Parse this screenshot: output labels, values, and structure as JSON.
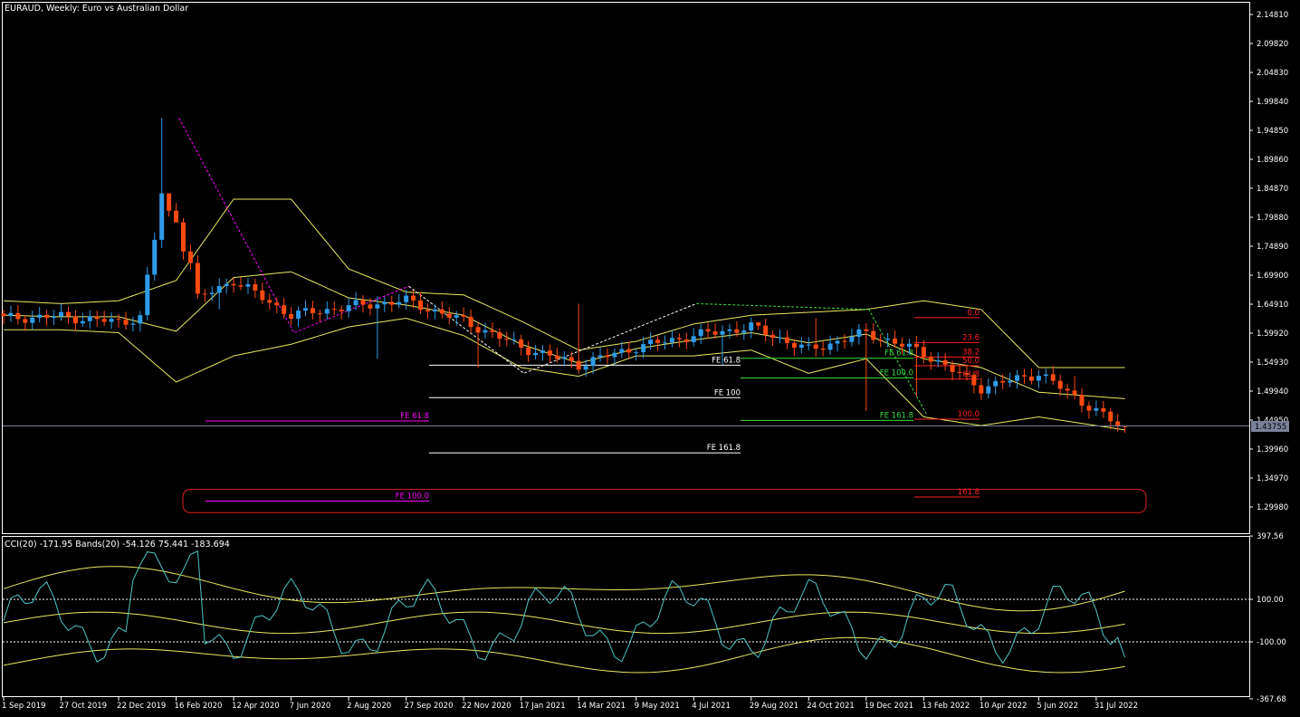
{
  "header": {
    "main_title": "EURAUD, Weekly:  Euro vs Australian Dollar",
    "indicator_title": "CCI(20) -171.95 Bands(20) -54.126 75.441 -183.694"
  },
  "colors": {
    "background": "#000000",
    "bull": "#2E9BE8",
    "bear": "#FF4A10",
    "bands": "#E8E860",
    "cci": "#4FC4C4",
    "fib_white": "#FFFFFF",
    "fib_magenta": "#FF00FF",
    "fib_green": "#3CDC3C",
    "fib_red": "#FF2020",
    "price_line": "#7A8299"
  },
  "price_axis": {
    "ticks": [
      "2.14810",
      "2.09820",
      "2.04830",
      "1.99840",
      "1.94850",
      "1.89860",
      "1.84870",
      "1.79880",
      "1.74890",
      "1.69900",
      "1.64910",
      "1.59920",
      "1.54930",
      "1.49940",
      "1.44950",
      "1.39960",
      "1.34970",
      "1.29980"
    ],
    "current_price": "1.43755"
  },
  "cci_axis": {
    "ticks": [
      "397.56",
      "100.00",
      "-100.00",
      "-367.68"
    ]
  },
  "time_axis": {
    "labels": [
      "1 Sep 2019",
      "27 Oct 2019",
      "22 Dec 2019",
      "16 Feb 2020",
      "12 Apr 2020",
      "7 Jun 2020",
      "2 Aug 2020",
      "27 Sep 2020",
      "22 Nov 2020",
      "17 Jan 2021",
      "14 Mar 2021",
      "9 May 2021",
      "4 Jul 2021",
      "29 Aug 2021",
      "24 Oct 2021",
      "19 Dec 2021",
      "13 Feb 2022",
      "10 Apr 2022",
      "5 Jun 2022",
      "31 Jul 2022"
    ]
  },
  "fib_labels": {
    "magenta_61": "FE 61.8",
    "magenta_100": "FE 100.0",
    "white_61": "FE 61.8",
    "white_100": "FE 100",
    "white_161": "FE 161.8",
    "green_61": "FE 61.8",
    "green_100": "FE 100.0",
    "green_161": "FE 161.8",
    "red_0": "0.0",
    "red_23": "23.6",
    "red_38": "38.2",
    "red_50": "50.0",
    "red_61": "61.8",
    "red_100": "100.0",
    "red_161": "161.8"
  },
  "chart_data": {
    "type": "candlestick",
    "symbol": "EURAUD",
    "timeframe": "Weekly",
    "ylim": [
      1.274,
      2.168
    ],
    "dates": [
      "1 Sep 2019",
      "27 Oct 2019",
      "22 Dec 2019",
      "16 Feb 2020",
      "12 Apr 2020",
      "7 Jun 2020",
      "2 Aug 2020",
      "27 Sep 2020",
      "22 Nov 2020",
      "17 Jan 2021",
      "14 Mar 2021",
      "9 May 2021",
      "4 Jul 2021",
      "29 Aug 2021",
      "24 Oct 2021",
      "19 Dec 2021",
      "13 Feb 2022",
      "10 Apr 2022",
      "5 Jun 2022",
      "31 Jul 2022"
    ],
    "close_key": [
      1.625,
      1.628,
      1.618,
      1.64,
      1.69,
      1.63,
      1.645,
      1.655,
      1.62,
      1.575,
      1.545,
      1.575,
      1.595,
      1.61,
      1.57,
      1.6,
      1.565,
      1.505,
      1.53,
      1.465
    ],
    "swing_points": [
      {
        "date": "16 Feb 2020",
        "value": 1.97
      },
      {
        "date": "7 Jun 2020",
        "value": 1.6
      },
      {
        "date": "27 Sep 2020",
        "value": 1.68
      },
      {
        "date": "17 Jan 2021",
        "value": 1.53
      },
      {
        "date": "4 Jul 2021",
        "value": 1.65
      },
      {
        "date": "19 Dec 2021",
        "value": 1.64
      },
      {
        "date": "13 Feb 2022",
        "value": 1.46
      }
    ],
    "last_price": 1.43755,
    "bollinger_key": {
      "upper": [
        1.655,
        1.65,
        1.655,
        1.69,
        1.83,
        1.83,
        1.71,
        1.67,
        1.665,
        1.62,
        1.57,
        1.585,
        1.615,
        1.63,
        1.635,
        1.64,
        1.655,
        1.64,
        1.54,
        1.54
      ],
      "lower": [
        1.605,
        1.605,
        1.6,
        1.515,
        1.56,
        1.58,
        1.61,
        1.625,
        1.595,
        1.54,
        1.525,
        1.56,
        1.56,
        1.57,
        1.53,
        1.555,
        1.455,
        1.44,
        1.455,
        1.44
      ]
    },
    "fibonacci_expansions": [
      {
        "color": "magenta",
        "levels": [
          {
            "name": "FE 61.8",
            "value": 1.448
          },
          {
            "name": "FE 100.0",
            "value": 1.31
          }
        ]
      },
      {
        "color": "white",
        "levels": [
          {
            "name": "FE 61.8",
            "value": 1.544
          },
          {
            "name": "FE 100",
            "value": 1.488
          },
          {
            "name": "FE 161.8",
            "value": 1.393
          }
        ]
      },
      {
        "color": "green",
        "levels": [
          {
            "name": "FE 61.8",
            "value": 1.556
          },
          {
            "name": "FE 100.0",
            "value": 1.522
          },
          {
            "name": "FE 161.8",
            "value": 1.449
          }
        ]
      }
    ],
    "fibonacci_retracement": {
      "levels": [
        {
          "name": "0.0",
          "value": 1.626
        },
        {
          "name": "23.6",
          "value": 1.583
        },
        {
          "name": "38.2",
          "value": 1.558
        },
        {
          "name": "50.0",
          "value": 1.543
        },
        {
          "name": "61.8",
          "value": 1.52
        },
        {
          "name": "100.0",
          "value": 1.451
        },
        {
          "name": "161.8",
          "value": 1.317
        }
      ]
    },
    "cci": {
      "ylim": [
        -367.68,
        397.56
      ],
      "levels": [
        100,
        -100
      ],
      "last": -171.95,
      "bands_last": {
        "middle": -54.126,
        "upper": 75.441,
        "lower": -183.694
      }
    }
  }
}
